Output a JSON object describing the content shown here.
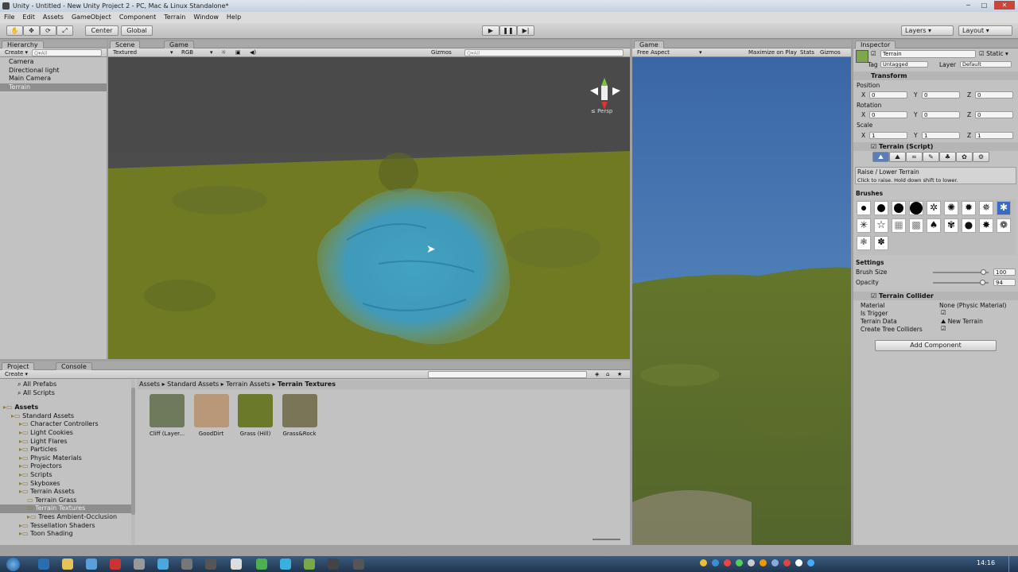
{
  "window": {
    "title": "Unity - Untitled - New Unity Project 2 - PC, Mac & Linux Standalone*"
  },
  "menu": [
    "File",
    "Edit",
    "Assets",
    "GameObject",
    "Component",
    "Terrain",
    "Window",
    "Help"
  ],
  "toolbar": {
    "center": "Center",
    "global": "Global",
    "layers": "Layers",
    "layout": "Layout"
  },
  "hierarchy": {
    "tab": "Hierarchy",
    "create": "Create",
    "search_placeholder": "Q▾All",
    "items": [
      "Camera",
      "Directional light",
      "Main Camera",
      "Terrain"
    ]
  },
  "scene": {
    "tab_scene": "Scene",
    "tab_game": "Game",
    "shading": "Textured",
    "render": "RGB",
    "gizmos": "Gizmos",
    "search_placeholder": "Q▾All",
    "persp": "≤ Persp"
  },
  "game": {
    "tab": "Game",
    "aspect": "Free Aspect",
    "maximize": "Maximize on Play",
    "stats": "Stats",
    "gizmos": "Gizmos"
  },
  "inspector": {
    "tab": "Inspector",
    "object_name": "Terrain",
    "static": "Static",
    "tag_label": "Tag",
    "tag": "Untagged",
    "layer_label": "Layer",
    "layer": "Default",
    "transform": {
      "title": "Transform",
      "position": "Position",
      "rotation": "Rotation",
      "scale": "Scale",
      "x": "X",
      "y": "Y",
      "z": "Z",
      "pos": [
        "0",
        "0",
        "0"
      ],
      "rot": [
        "0",
        "0",
        "0"
      ],
      "scl": [
        "1",
        "1",
        "1"
      ]
    },
    "terrain_script": {
      "title": "Terrain (Script)",
      "tool_title": "Raise / Lower Terrain",
      "tool_hint": "Click to raise. Hold down shift to lower.",
      "brushes": "Brushes",
      "settings": "Settings",
      "brush_size_label": "Brush Size",
      "brush_size": "100",
      "opacity_label": "Opacity",
      "opacity": "94",
      "brush_size_frac": 0.96,
      "opacity_frac": 0.93
    },
    "collider": {
      "title": "Terrain Collider",
      "material_label": "Material",
      "material": "None (Physic Material)",
      "trigger_label": "Is Trigger",
      "data_label": "Terrain Data",
      "data": "New Terrain",
      "trees_label": "Create Tree Colliders"
    },
    "add_component": "Add Component"
  },
  "project": {
    "tab_project": "Project",
    "tab_console": "Console",
    "create": "Create",
    "favorites": [
      "All Prefabs",
      "All Scripts"
    ],
    "tree": [
      {
        "label": "Assets",
        "indent": 0,
        "bold": true
      },
      {
        "label": "Standard Assets",
        "indent": 1
      },
      {
        "label": "Character Controllers",
        "indent": 2
      },
      {
        "label": "Light Cookies",
        "indent": 2
      },
      {
        "label": "Light Flares",
        "indent": 2
      },
      {
        "label": "Particles",
        "indent": 2
      },
      {
        "label": "Physic Materials",
        "indent": 2
      },
      {
        "label": "Projectors",
        "indent": 2
      },
      {
        "label": "Scripts",
        "indent": 2
      },
      {
        "label": "Skyboxes",
        "indent": 2
      },
      {
        "label": "Terrain Assets",
        "indent": 2
      },
      {
        "label": "Terrain Grass",
        "indent": 3
      },
      {
        "label": "Terrain Textures",
        "indent": 3,
        "selected": true
      },
      {
        "label": "Trees Ambient-Occlusion",
        "indent": 3
      },
      {
        "label": "Tessellation Shaders",
        "indent": 2
      },
      {
        "label": "Toon Shading",
        "indent": 2
      }
    ],
    "breadcrumb": [
      "Assets",
      "Standard Assets",
      "Terrain Assets",
      "Terrain Textures"
    ],
    "assets": [
      {
        "name": "Cliff (Layer...",
        "color": "#6f7a5c"
      },
      {
        "name": "GoodDirt",
        "color": "#b9987a"
      },
      {
        "name": "Grass (Hill)",
        "color": "#6b7a2a"
      },
      {
        "name": "Grass&Rock",
        "color": "#7a7556"
      }
    ]
  },
  "taskbar": {
    "time": "14:16"
  }
}
